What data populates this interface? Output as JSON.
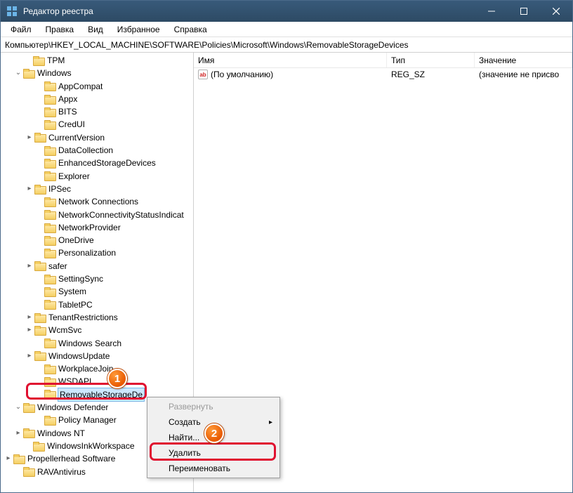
{
  "titlebar": {
    "title": "Редактор реестра"
  },
  "menu": {
    "file": "Файл",
    "edit": "Правка",
    "view": "Вид",
    "favorites": "Избранное",
    "help": "Справка"
  },
  "address": "Компьютер\\HKEY_LOCAL_MACHINE\\SOFTWARE\\Policies\\Microsoft\\Windows\\RemovableStorageDevices",
  "columns": {
    "name": "Имя",
    "type": "Тип",
    "value": "Значение"
  },
  "row0": {
    "name": "(По умолчанию)",
    "type": "REG_SZ",
    "value": "(значение не присво"
  },
  "tree": {
    "n0": "TPM",
    "n1": "Windows",
    "n2": "AppCompat",
    "n3": "Appx",
    "n4": "BITS",
    "n5": "CredUI",
    "n6": "CurrentVersion",
    "n7": "DataCollection",
    "n8": "EnhancedStorageDevices",
    "n9": "Explorer",
    "n10": "IPSec",
    "n11": "Network Connections",
    "n12": "NetworkConnectivityStatusIndicat",
    "n13": "NetworkProvider",
    "n14": "OneDrive",
    "n15": "Personalization",
    "n16": "safer",
    "n17": "SettingSync",
    "n18": "System",
    "n19": "TabletPC",
    "n20": "TenantRestrictions",
    "n21": "WcmSvc",
    "n22": "Windows Search",
    "n23": "WindowsUpdate",
    "n24": "WorkplaceJoin",
    "n25": "WSDAPI",
    "n26": "RemovableStorageDe",
    "n27": "Windows Defender",
    "n28": "Policy Manager",
    "n29": "Windows NT",
    "n30": "WindowsInkWorkspace",
    "n31": "Propellerhead Software",
    "n32": "RAVAntivirus"
  },
  "context": {
    "expand": "Развернуть",
    "new": "Создать",
    "find": "Найти...",
    "delete": "Удалить",
    "rename": "Переименовать"
  },
  "markers": {
    "m1": "1",
    "m2": "2"
  }
}
